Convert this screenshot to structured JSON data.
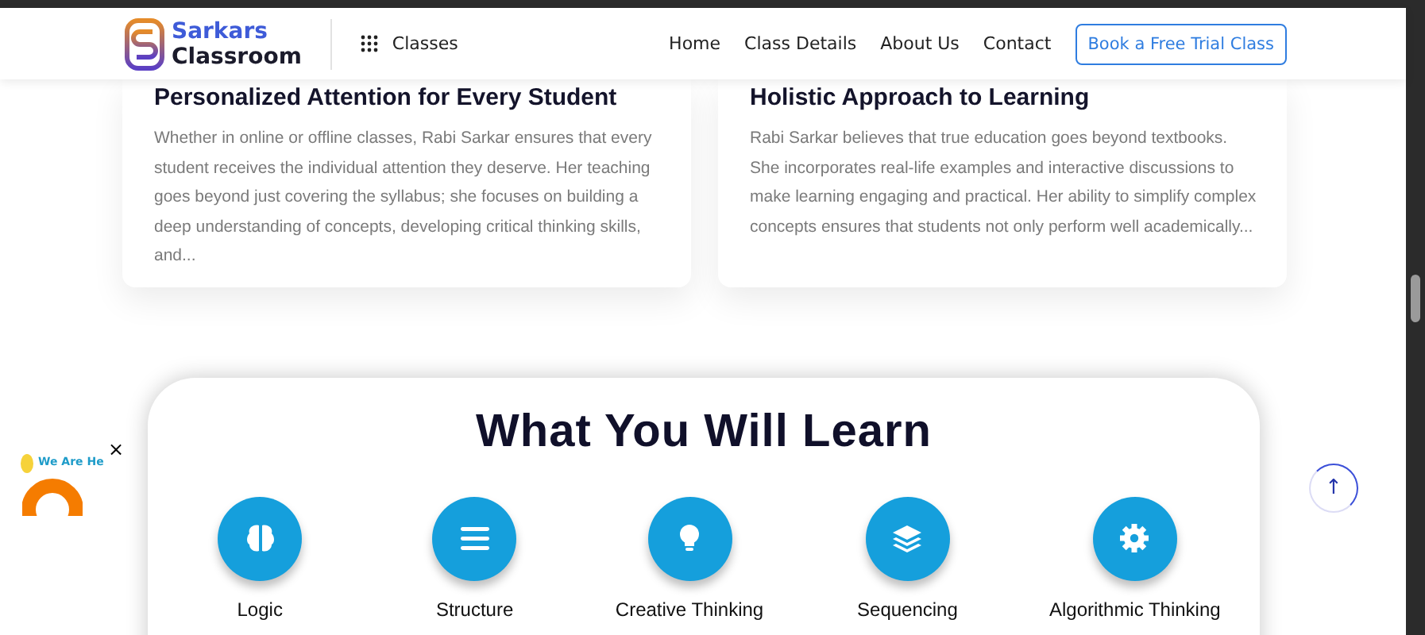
{
  "header": {
    "logo_line1": "Sarkars",
    "logo_line2": "Classroom",
    "classes_menu": "Classes",
    "nav": [
      {
        "label": "Home"
      },
      {
        "label": "Class Details"
      },
      {
        "label": "About Us"
      },
      {
        "label": "Contact"
      }
    ],
    "cta": "Book a Free Trial Class"
  },
  "cards": [
    {
      "title": "Personalized Attention for Every Student",
      "text": "Whether in online or offline classes, Rabi Sarkar ensures that every student receives the individual attention they deserve. Her teaching goes beyond just covering the syllabus; she focuses on building a deep understanding of concepts, developing critical thinking skills, and..."
    },
    {
      "title": "Holistic Approach to Learning",
      "text": "Rabi Sarkar believes that true education goes beyond textbooks. She incorporates real-life examples and interactive discussions to make learning engaging and practical. Her ability to simplify complex concepts ensures that students not only perform well academically..."
    }
  ],
  "learn": {
    "title": "What You Will Learn",
    "items": [
      {
        "label": "Logic"
      },
      {
        "label": "Structure"
      },
      {
        "label": "Creative Thinking"
      },
      {
        "label": "Sequencing"
      },
      {
        "label": "Algorithmic Thinking"
      }
    ]
  },
  "widget": {
    "text": "We Are He",
    "close": "×"
  },
  "scroll_top": "↑"
}
